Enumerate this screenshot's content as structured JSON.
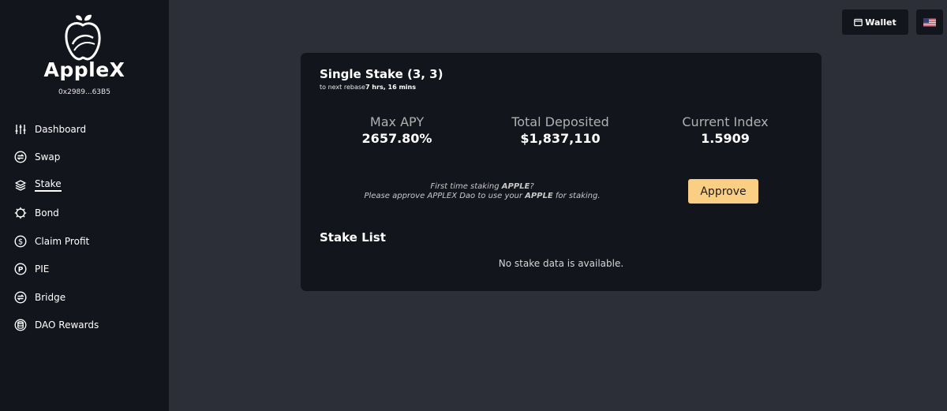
{
  "sidebar": {
    "brand": "AppleX",
    "address": "0x2989...63B5",
    "items": [
      {
        "label": "Dashboard",
        "icon": "sliders-icon",
        "active": false
      },
      {
        "label": "Swap",
        "icon": "swap-icon",
        "active": false
      },
      {
        "label": "Stake",
        "icon": "layers-icon",
        "active": true
      },
      {
        "label": "Bond",
        "icon": "gear-icon",
        "active": false
      },
      {
        "label": "Claim Profit",
        "icon": "dollar-icon",
        "active": false
      },
      {
        "label": "PIE",
        "icon": "p-coin-icon",
        "active": false
      },
      {
        "label": "Bridge",
        "icon": "bridge-icon",
        "active": false
      },
      {
        "label": "DAO Rewards",
        "icon": "database-icon",
        "active": false
      }
    ]
  },
  "header": {
    "wallet_label": "Wallet",
    "language_icon": "us-flag-icon"
  },
  "stake": {
    "title": "Single Stake (3, 3)",
    "rebase_prefix": "to next rebase",
    "rebase_time": "7 hrs, 16 mins",
    "stats": [
      {
        "label": "Max APY",
        "value": "2657.80%"
      },
      {
        "label": "Total Deposited",
        "value": "$1,837,110"
      },
      {
        "label": "Current Index",
        "value": "1.5909"
      }
    ],
    "approve_line1_prefix": "First time staking ",
    "approve_token": "APPLE",
    "approve_line1_suffix": "?",
    "approve_line2_prefix": "Please approve APPLEX Dao to use your ",
    "approve_line2_suffix": " for staking.",
    "approve_button": "Approve",
    "list_title": "Stake List",
    "empty_message": "No stake data is available."
  },
  "colors": {
    "background": "#2c2f37",
    "panel": "#13151d",
    "accent": "#fbcf83"
  }
}
